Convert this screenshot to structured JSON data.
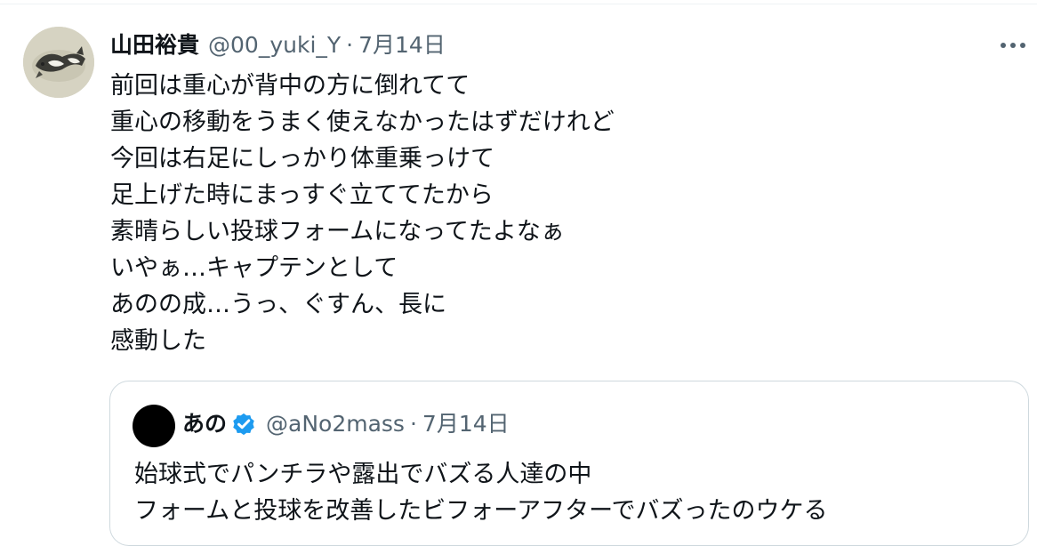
{
  "tweet": {
    "author": {
      "name": "山田裕貴",
      "handle": "@00_yuki_Y",
      "date": "7月14日"
    },
    "separator": "·",
    "body_lines": [
      "前回は重心が背中の方に倒れてて",
      "重心の移動をうまく使えなかったはずだけれど",
      "今回は右足にしっかり体重乗っけて",
      "足上げた時にまっすぐ立ててたから",
      "素晴らしい投球フォームになってたよなぁ",
      "いやぁ…キャプテンとして",
      "あのの成…うっ、ぐすん、長に",
      "感動した"
    ],
    "more_icon": "more-horizontal-icon"
  },
  "quote": {
    "author": {
      "name": "あの",
      "handle": "@aNo2mass",
      "date": "7月14日",
      "verified": true
    },
    "separator": "·",
    "text_lines": [
      "始球式でパンチラや露出でバズる人達の中",
      "フォームと投球を改善したビフォーアフターでバズったのウケる"
    ],
    "verified_icon": "verified-badge-icon",
    "verified_color": "#1d9bf0"
  },
  "colors": {
    "text_primary": "#0f1419",
    "text_secondary": "#536471",
    "border": "#cfd9de"
  }
}
